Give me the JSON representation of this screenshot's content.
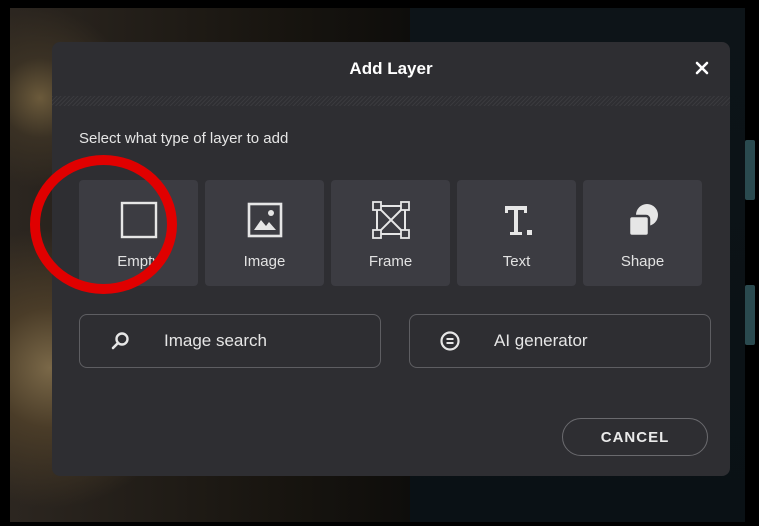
{
  "dialog": {
    "title": "Add Layer",
    "prompt": "Select what type of layer to add",
    "tiles": [
      {
        "label": "Empty",
        "icon": "empty-layer-icon"
      },
      {
        "label": "Image",
        "icon": "image-icon"
      },
      {
        "label": "Frame",
        "icon": "frame-icon"
      },
      {
        "label": "Text",
        "icon": "text-icon"
      },
      {
        "label": "Shape",
        "icon": "shape-icon"
      }
    ],
    "image_search_label": "Image search",
    "ai_generator_label": "AI generator",
    "cancel_label": "CANCEL"
  },
  "colors": {
    "dialog_bg": "#2e2e32",
    "tile_bg": "#3c3c42",
    "annotation": "#e00000"
  }
}
